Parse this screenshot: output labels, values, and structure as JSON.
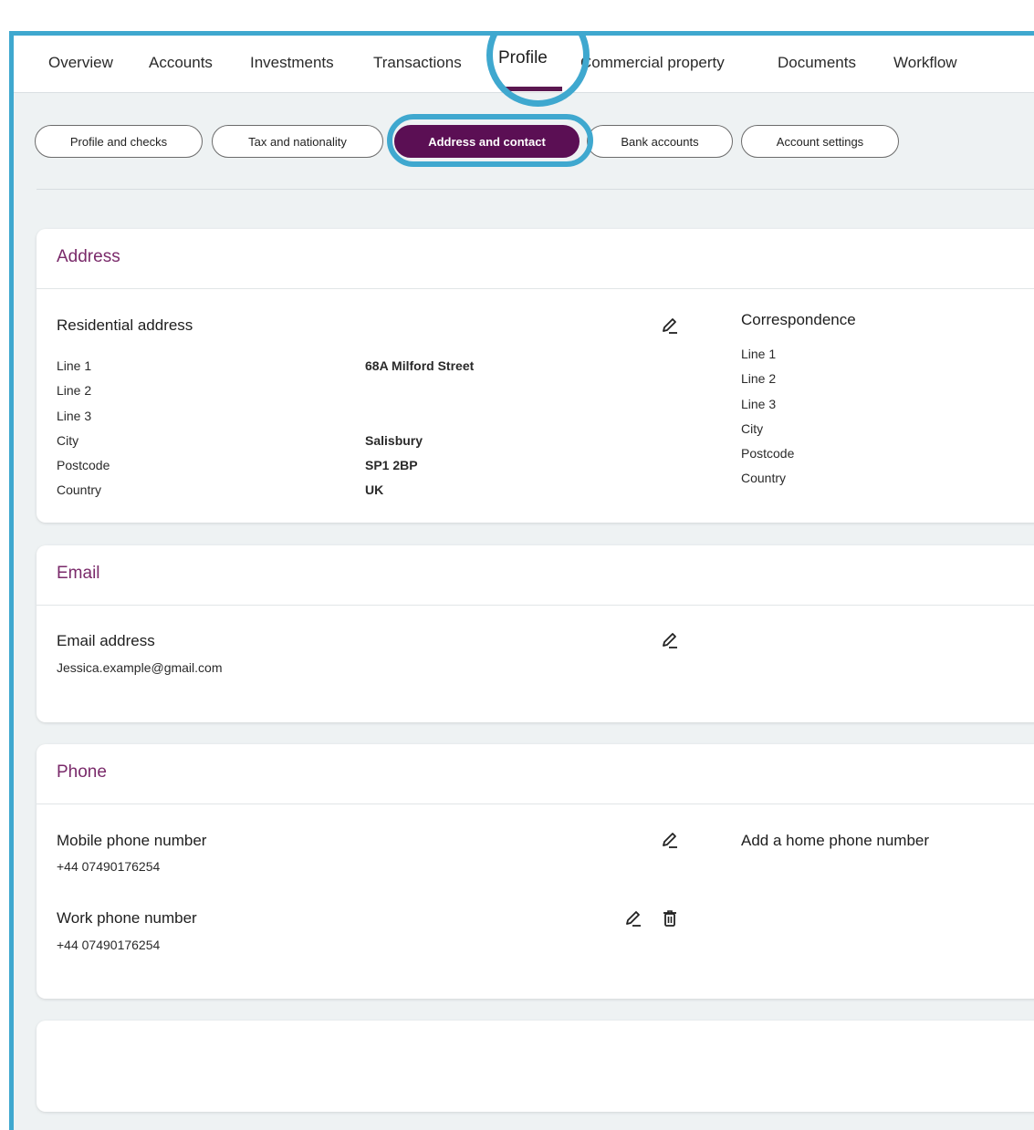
{
  "nav": {
    "items": [
      "Overview",
      "Accounts",
      "Investments",
      "Transactions",
      "Profile",
      "Commercial property",
      "Documents",
      "Workflow"
    ],
    "active": "Profile"
  },
  "subnav": {
    "pills": [
      "Profile and checks",
      "Tax and nationality",
      "Address and contact",
      "Bank accounts",
      "Account settings"
    ],
    "active": "Address and contact"
  },
  "address": {
    "title": "Address",
    "residential": {
      "heading": "Residential address",
      "labels": [
        "Line 1",
        "Line 2",
        "Line 3",
        "City",
        "Postcode",
        "Country"
      ],
      "values": [
        "68A Milford Street",
        "",
        "",
        "Salisbury",
        "SP1 2BP",
        "UK"
      ]
    },
    "correspondence": {
      "heading": "Correspondence",
      "labels": [
        "Line 1",
        "Line 2",
        "Line 3",
        "City",
        "Postcode",
        "Country"
      ]
    }
  },
  "email": {
    "title": "Email",
    "heading": "Email address",
    "value": "Jessica.example@gmail.com"
  },
  "phone": {
    "title": "Phone",
    "mobile_heading": "Mobile phone number",
    "mobile_value": "+44 07490176254",
    "add_home": "Add a home phone number",
    "work_heading": "Work phone number",
    "work_value": "+44 07490176254"
  },
  "colors": {
    "accent": "#5b0f54",
    "highlight": "#3fa8cf",
    "section_title": "#7a2a6a"
  },
  "icons": [
    "pencil-icon",
    "trash-icon"
  ]
}
